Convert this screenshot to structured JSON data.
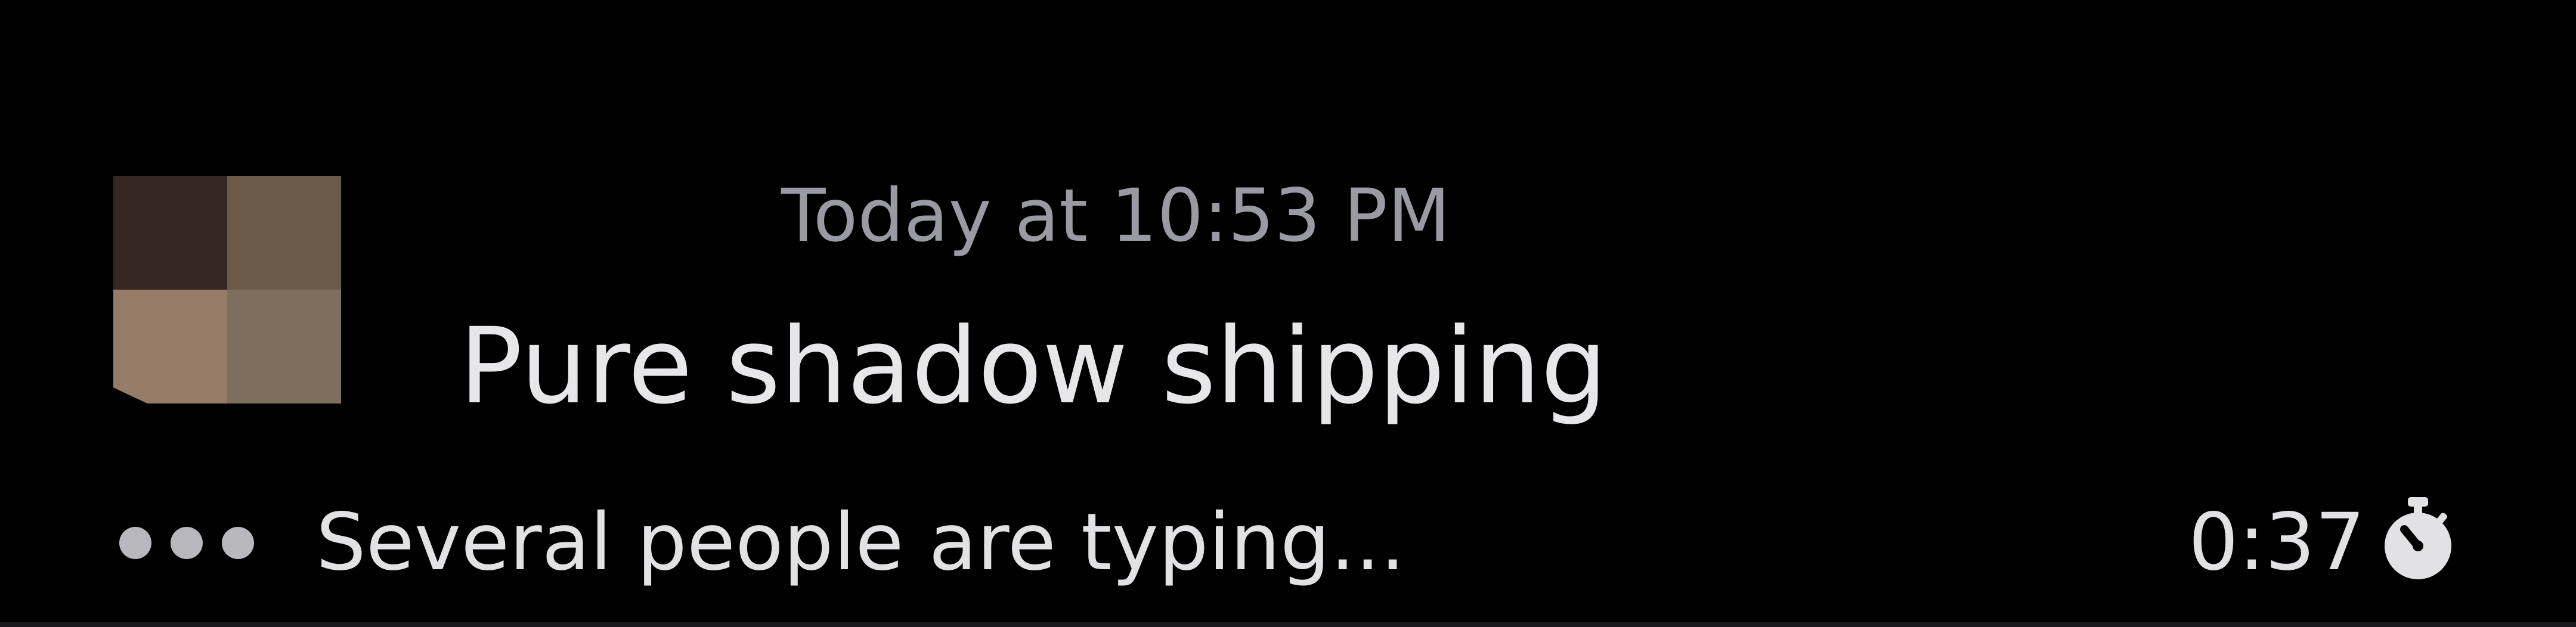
{
  "message": {
    "avatar": {
      "icon": "pixelated-avatar-icon",
      "colors": [
        "#352622",
        "#6b5a49",
        "#947c69",
        "#7e6e5d"
      ]
    },
    "timestamp": "Today at 10:53 PM",
    "text": "Pure shadow shipping"
  },
  "typing_indicator": {
    "icon": "typing-dots-icon",
    "text": "Several people are typing...",
    "timer": "0:37",
    "timer_icon": "stopwatch-icon"
  },
  "colors": {
    "background": "#000000",
    "timestamp": "#9a9aa3",
    "text": "#e7e7ea"
  }
}
